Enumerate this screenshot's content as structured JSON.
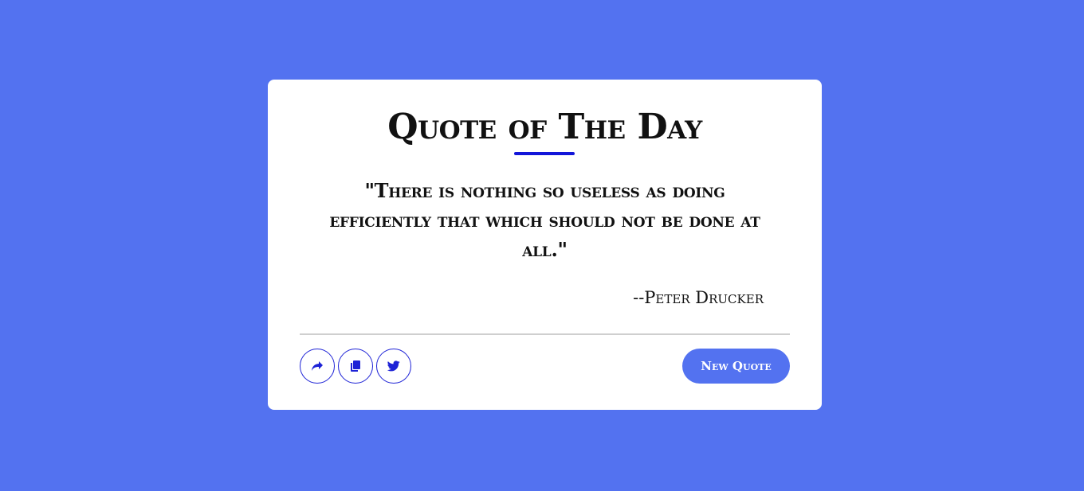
{
  "card": {
    "title": "Quote of The Day",
    "quote": "\"There is nothing so useless as doing efficiently that which should not be done at all.\"",
    "author": "--Peter Drucker",
    "new_quote_label": "New Quote"
  },
  "icons": {
    "share": "share-icon",
    "copy": "copy-icon",
    "twitter": "twitter-icon"
  },
  "colors": {
    "background": "#5372f0",
    "accent": "#1d22d6",
    "card": "#ffffff"
  }
}
